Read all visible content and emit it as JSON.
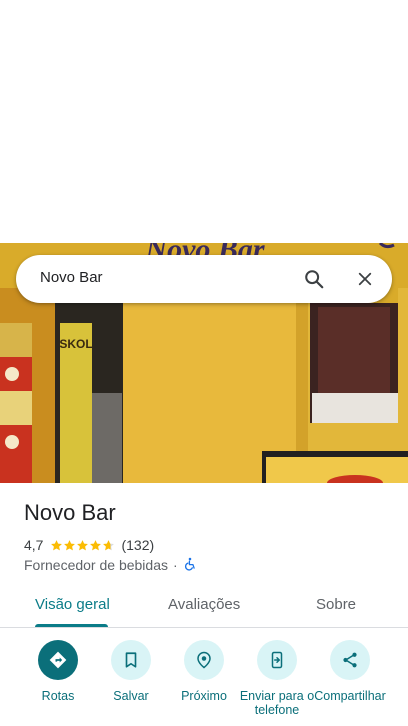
{
  "search": {
    "query": "Novo Bar",
    "search_icon": "search-icon",
    "clear_icon": "close-icon"
  },
  "photo": {
    "sign_text": "Novo Bar",
    "crate_text": "SKOL"
  },
  "place": {
    "name": "Novo Bar",
    "rating": "4,7",
    "rating_value": 4.7,
    "max_rating": 5,
    "review_count": "(132)",
    "category": "Fornecedor de bebidas",
    "separator": "·",
    "accessibility_icon": "wheelchair-icon"
  },
  "tabs": [
    {
      "label": "Visão geral",
      "active": true
    },
    {
      "label": "Avaliações",
      "active": false
    },
    {
      "label": "Sobre",
      "active": false
    }
  ],
  "actions": [
    {
      "label": "Rotas",
      "icon": "directions-icon"
    },
    {
      "label": "Salvar",
      "icon": "bookmark-icon"
    },
    {
      "label": "Próximo",
      "icon": "nearby-icon"
    },
    {
      "label": "Enviar para o telefone",
      "icon": "send-to-phone-icon"
    },
    {
      "label": "Compartilhar",
      "icon": "share-icon"
    }
  ],
  "colors": {
    "accent": "#0b7c88",
    "star": "#fbbc04",
    "action_bg": "#d9f4f6",
    "primary_action_bg": "#0b6f7a"
  }
}
